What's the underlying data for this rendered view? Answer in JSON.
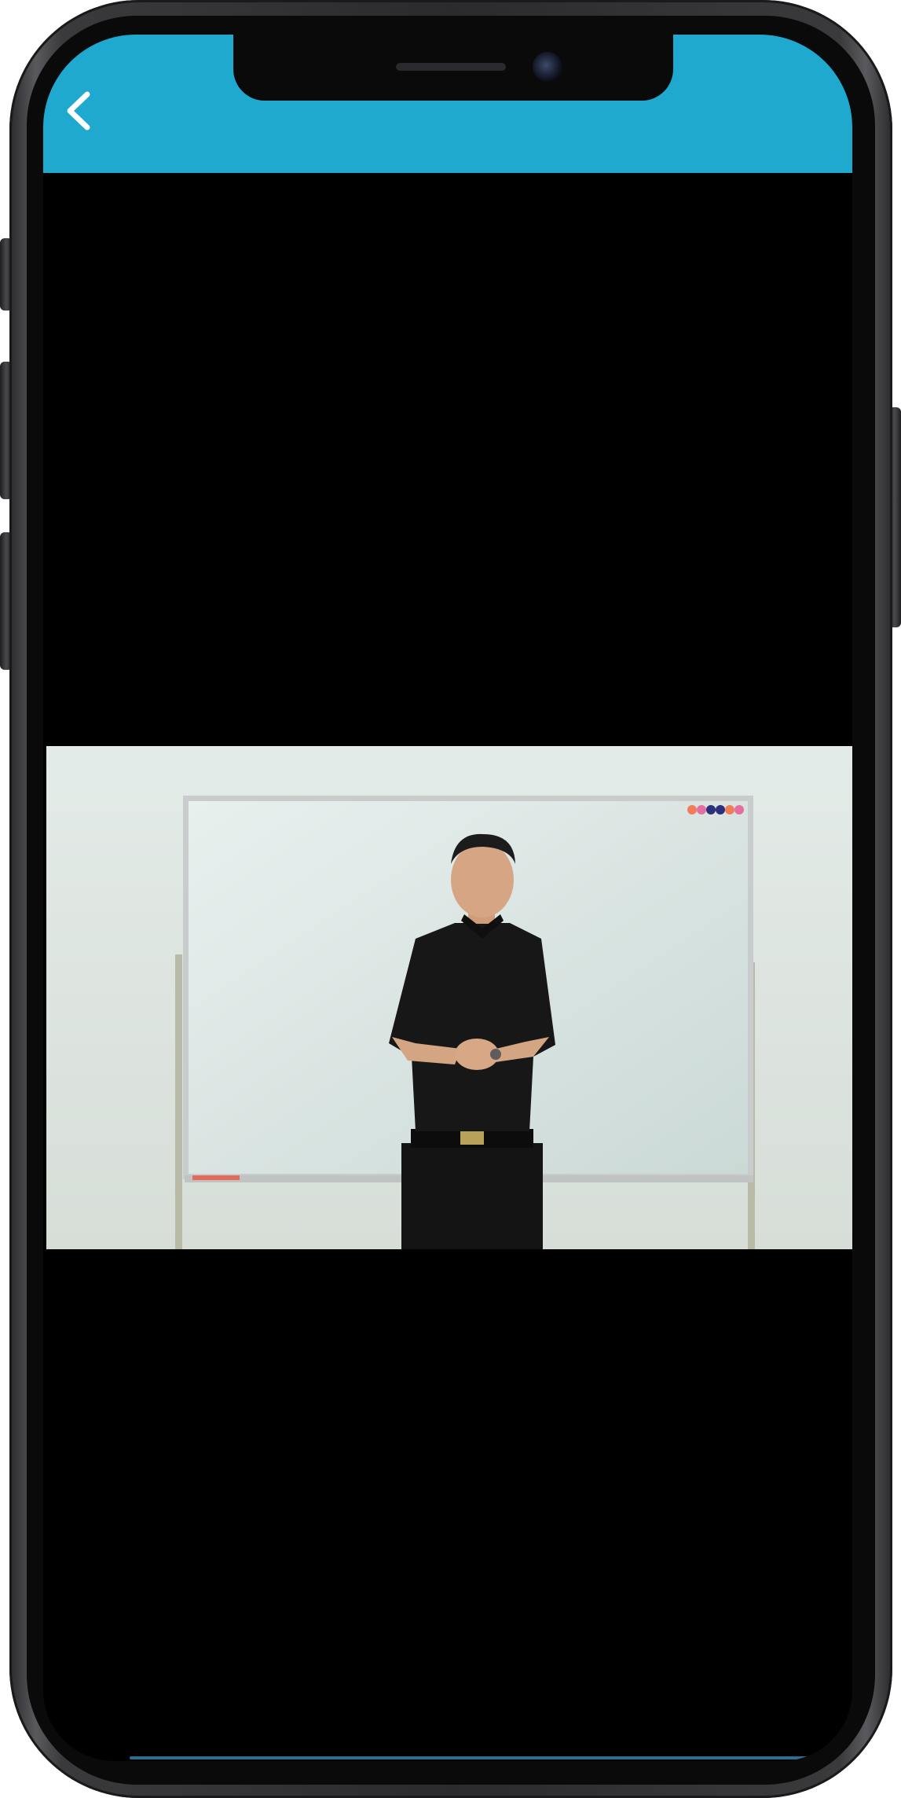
{
  "header": {
    "title": "",
    "back_icon": "chevron-left-icon",
    "accent_color": "#1fa9cf"
  },
  "video": {
    "description_icon": "play-video-frame",
    "background_color": "#000000"
  }
}
